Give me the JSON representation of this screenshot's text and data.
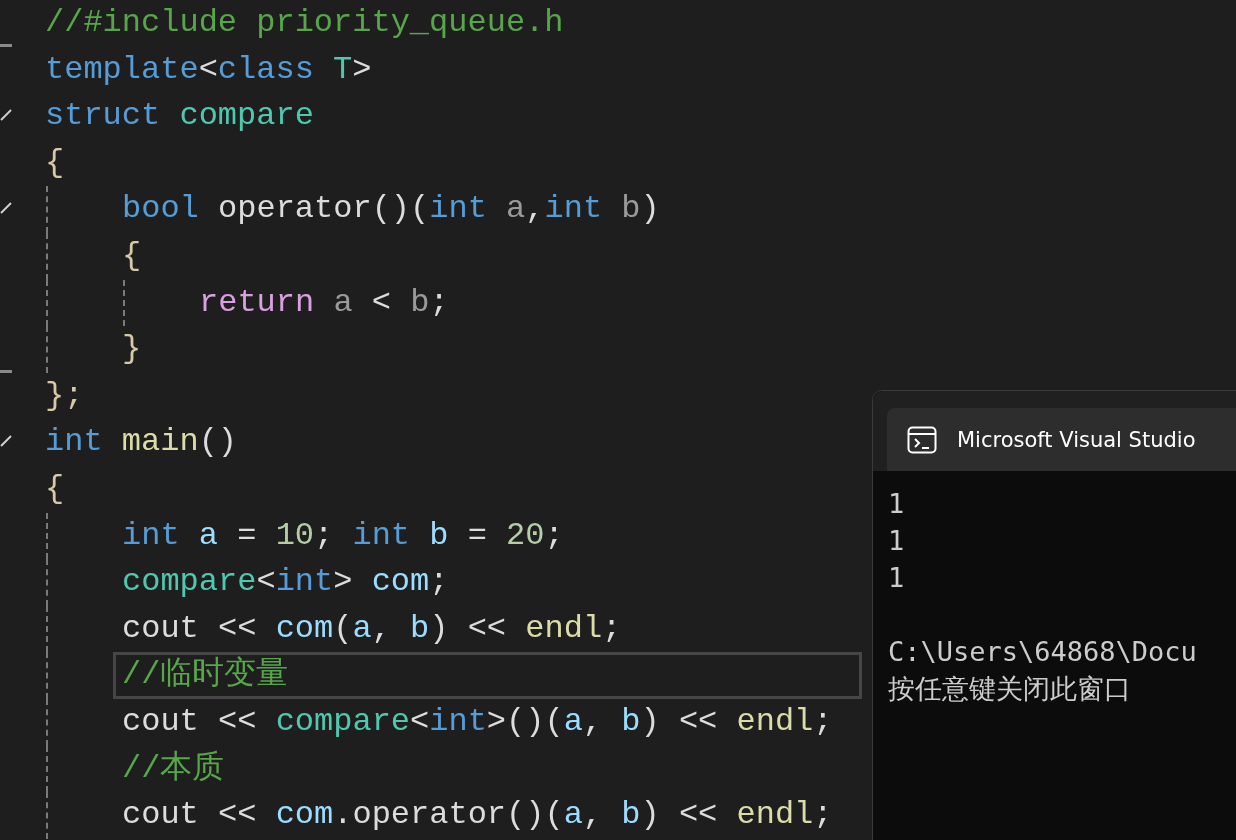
{
  "editor": {
    "lines": [
      {
        "fold_end": true,
        "tokens": [
          {
            "text": "//#include priority_queue.h",
            "kind": "comment"
          }
        ]
      },
      {
        "tokens": [
          {
            "text": "template",
            "kind": "kw"
          },
          {
            "text": "<",
            "kind": "plain"
          },
          {
            "text": "class",
            "kind": "kw"
          },
          {
            "text": " T",
            "kind": "type"
          },
          {
            "text": ">",
            "kind": "plain"
          }
        ]
      },
      {
        "fold_start": true,
        "tokens": [
          {
            "text": "struct",
            "kind": "kw"
          },
          {
            "text": " compare",
            "kind": "type"
          }
        ]
      },
      {
        "tokens": [
          {
            "text": "{",
            "kind": "brace"
          }
        ],
        "children": [
          {
            "fold_start": true,
            "tokens": [
              {
                "text": "bool",
                "kind": "kw"
              },
              {
                "text": " operator()(",
                "kind": "plain"
              },
              {
                "text": "int",
                "kind": "kw"
              },
              {
                "text": " a",
                "kind": "param"
              },
              {
                "text": ",",
                "kind": "plain"
              },
              {
                "text": "int",
                "kind": "kw"
              },
              {
                "text": " b",
                "kind": "param"
              },
              {
                "text": ")",
                "kind": "plain"
              }
            ]
          },
          {
            "tokens": [
              {
                "text": "{",
                "kind": "brace"
              }
            ],
            "children": [
              {
                "tokens": [
                  {
                    "text": "return",
                    "kind": "ctl"
                  },
                  {
                    "text": " a",
                    "kind": "param"
                  },
                  {
                    "text": " < ",
                    "kind": "plain"
                  },
                  {
                    "text": "b",
                    "kind": "param"
                  },
                  {
                    "text": ";",
                    "kind": "plain"
                  }
                ]
              }
            ]
          },
          {
            "fold_end": true,
            "tokens": [
              {
                "text": "}",
                "kind": "brace"
              }
            ]
          }
        ]
      },
      {
        "tokens": [
          {
            "text": "};",
            "kind": "brace"
          }
        ]
      },
      {
        "fold_start": true,
        "tokens": [
          {
            "text": "int",
            "kind": "kw"
          },
          {
            "text": " main",
            "kind": "fn"
          },
          {
            "text": "()",
            "kind": "plain"
          }
        ]
      },
      {
        "tokens": [
          {
            "text": "{",
            "kind": "brace"
          }
        ],
        "children": [
          {
            "tokens": [
              {
                "text": "int",
                "kind": "kw"
              },
              {
                "text": " a",
                "kind": "var"
              },
              {
                "text": " = ",
                "kind": "plain"
              },
              {
                "text": "10",
                "kind": "num"
              },
              {
                "text": "; ",
                "kind": "plain"
              },
              {
                "text": "int",
                "kind": "kw"
              },
              {
                "text": " b",
                "kind": "var"
              },
              {
                "text": " = ",
                "kind": "plain"
              },
              {
                "text": "20",
                "kind": "num"
              },
              {
                "text": ";",
                "kind": "plain"
              }
            ]
          },
          {
            "tokens": [
              {
                "text": "compare",
                "kind": "type"
              },
              {
                "text": "<",
                "kind": "plain"
              },
              {
                "text": "int",
                "kind": "kw"
              },
              {
                "text": "> ",
                "kind": "plain"
              },
              {
                "text": "com",
                "kind": "var"
              },
              {
                "text": ";",
                "kind": "plain"
              }
            ]
          },
          {
            "tokens": [
              {
                "text": "cout << ",
                "kind": "plain"
              },
              {
                "text": "com",
                "kind": "var"
              },
              {
                "text": "(",
                "kind": "plain"
              },
              {
                "text": "a",
                "kind": "var"
              },
              {
                "text": ", ",
                "kind": "plain"
              },
              {
                "text": "b",
                "kind": "var"
              },
              {
                "text": ") << ",
                "kind": "plain"
              },
              {
                "text": "endl",
                "kind": "fn"
              },
              {
                "text": ";",
                "kind": "plain"
              }
            ]
          },
          {
            "selected": true,
            "tokens": [
              {
                "text": "//临时变量",
                "kind": "comment"
              }
            ]
          },
          {
            "tokens": [
              {
                "text": "cout << ",
                "kind": "plain"
              },
              {
                "text": "compare",
                "kind": "type"
              },
              {
                "text": "<",
                "kind": "plain"
              },
              {
                "text": "int",
                "kind": "kw"
              },
              {
                "text": ">()(",
                "kind": "plain"
              },
              {
                "text": "a",
                "kind": "var"
              },
              {
                "text": ", ",
                "kind": "plain"
              },
              {
                "text": "b",
                "kind": "var"
              },
              {
                "text": ") << ",
                "kind": "plain"
              },
              {
                "text": "endl",
                "kind": "fn"
              },
              {
                "text": ";",
                "kind": "plain"
              }
            ]
          },
          {
            "tokens": [
              {
                "text": "//本质",
                "kind": "comment"
              }
            ]
          },
          {
            "tokens": [
              {
                "text": "cout << ",
                "kind": "plain"
              },
              {
                "text": "com",
                "kind": "var"
              },
              {
                "text": ".operator()(",
                "kind": "plain"
              },
              {
                "text": "a",
                "kind": "var"
              },
              {
                "text": ", ",
                "kind": "plain"
              },
              {
                "text": "b",
                "kind": "var"
              },
              {
                "text": ") << ",
                "kind": "plain"
              },
              {
                "text": "endl",
                "kind": "fn"
              },
              {
                "text": ";",
                "kind": "plain"
              }
            ]
          }
        ]
      }
    ]
  },
  "console": {
    "title": "Microsoft Visual Studio",
    "output": [
      "1",
      "1",
      "1"
    ],
    "prompt": [
      "C:\\Users\\64868\\Docu",
      "按任意键关闭此窗口"
    ]
  }
}
